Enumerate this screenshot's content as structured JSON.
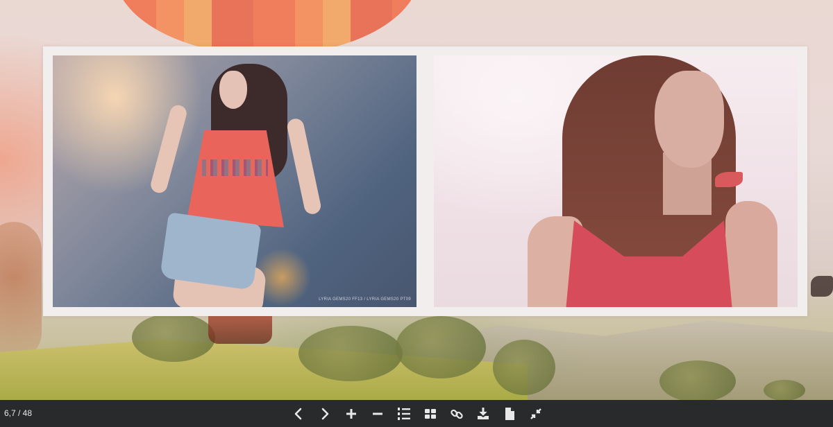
{
  "toolbar": {
    "page_counter": "6,7 / 48",
    "buttons": [
      {
        "name": "previous-page",
        "icon": "chevron-left-icon"
      },
      {
        "name": "next-page",
        "icon": "chevron-right-icon"
      },
      {
        "name": "zoom-in",
        "icon": "plus-icon"
      },
      {
        "name": "zoom-out",
        "icon": "minus-icon"
      },
      {
        "name": "table-of-contents",
        "icon": "numbered-list-icon"
      },
      {
        "name": "thumbnails",
        "icon": "grid-icon"
      },
      {
        "name": "share-link",
        "icon": "link-icon"
      },
      {
        "name": "download",
        "icon": "download-icon"
      },
      {
        "name": "single-page",
        "icon": "document-icon"
      },
      {
        "name": "exit-fullscreen",
        "icon": "compress-icon"
      }
    ]
  },
  "spread": {
    "left_photo_caption": "LYRIA GEMS20 FF13 / LYRIA GEMS20 PT09"
  },
  "colors": {
    "toolbar_bg": "#282a2c",
    "toolbar_icon": "#e8e8e8",
    "frame": "#f3eeee"
  }
}
